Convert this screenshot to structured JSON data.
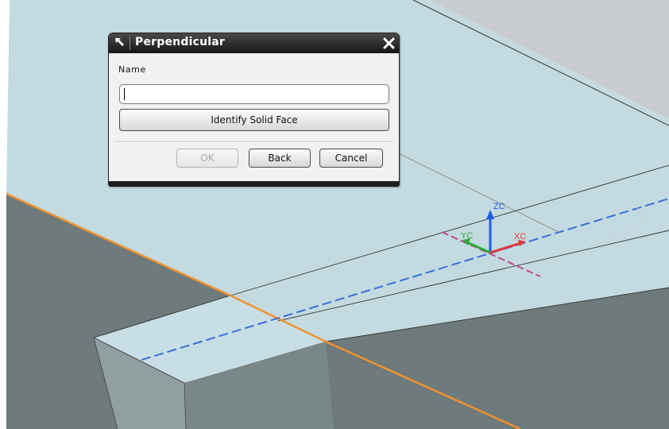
{
  "dialog": {
    "title": "Perpendicular",
    "name_label": "Name",
    "name_value": "",
    "identify_button": "Identify Solid Face",
    "ok_button": "OK",
    "back_button": "Back",
    "cancel_button": "Cancel",
    "ok_enabled": false
  },
  "triad": {
    "zc": "ZC",
    "yc": "YC",
    "xc": "XC",
    "zc_color": "#1e5be8",
    "yc_color": "#2ea83a",
    "xc_color": "#e23a3a"
  },
  "colors": {
    "face_top": "#c3dbe0",
    "face_side_dark": "#6e7a7b",
    "face_side_mid": "#8b9899",
    "edge_orange": "#f0922f",
    "centerline_blue": "#3a6fd8",
    "axis_dashed_magenta": "#c0488c"
  },
  "icons": [
    "dialog-arrow-icon",
    "close-icon"
  ]
}
